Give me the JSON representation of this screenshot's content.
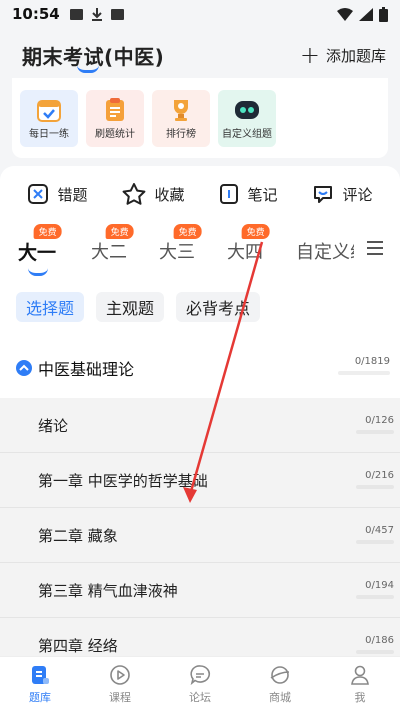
{
  "statusbar": {
    "time": "10:54"
  },
  "header": {
    "title": "期末考试(中医)",
    "add_label": "添加题库"
  },
  "tools": [
    {
      "label": "每日一练"
    },
    {
      "label": "刷题统计"
    },
    {
      "label": "排行榜"
    },
    {
      "label": "自定义组题"
    }
  ],
  "actions": [
    {
      "label": "错题"
    },
    {
      "label": "收藏"
    },
    {
      "label": "笔记"
    },
    {
      "label": "评论"
    }
  ],
  "grades": [
    {
      "label": "大一",
      "badge": "免费",
      "active": true
    },
    {
      "label": "大二",
      "badge": "免费"
    },
    {
      "label": "大三",
      "badge": "免费"
    },
    {
      "label": "大四",
      "badge": "免费"
    },
    {
      "label": "自定义组"
    }
  ],
  "question_types": [
    {
      "label": "选择题",
      "active": true
    },
    {
      "label": "主观题"
    },
    {
      "label": "必背考点"
    }
  ],
  "section": {
    "title": "中医基础理论",
    "progress": "0/1819"
  },
  "chapters": [
    {
      "title": "绪论",
      "progress": "0/126"
    },
    {
      "title": "第一章 中医学的哲学基础",
      "progress": "0/216"
    },
    {
      "title": "第二章 藏象",
      "progress": "0/457"
    },
    {
      "title": "第三章 精气血津液神",
      "progress": "0/194"
    },
    {
      "title": "第四章 经络",
      "progress": "0/186"
    }
  ],
  "bottomnav": [
    {
      "label": "题库",
      "active": true
    },
    {
      "label": "课程"
    },
    {
      "label": "论坛"
    },
    {
      "label": "商城"
    },
    {
      "label": "我"
    }
  ],
  "colors": {
    "accent": "#2f7df6",
    "badge": "#ff6a2a",
    "annotation_arrow": "#e53935"
  }
}
